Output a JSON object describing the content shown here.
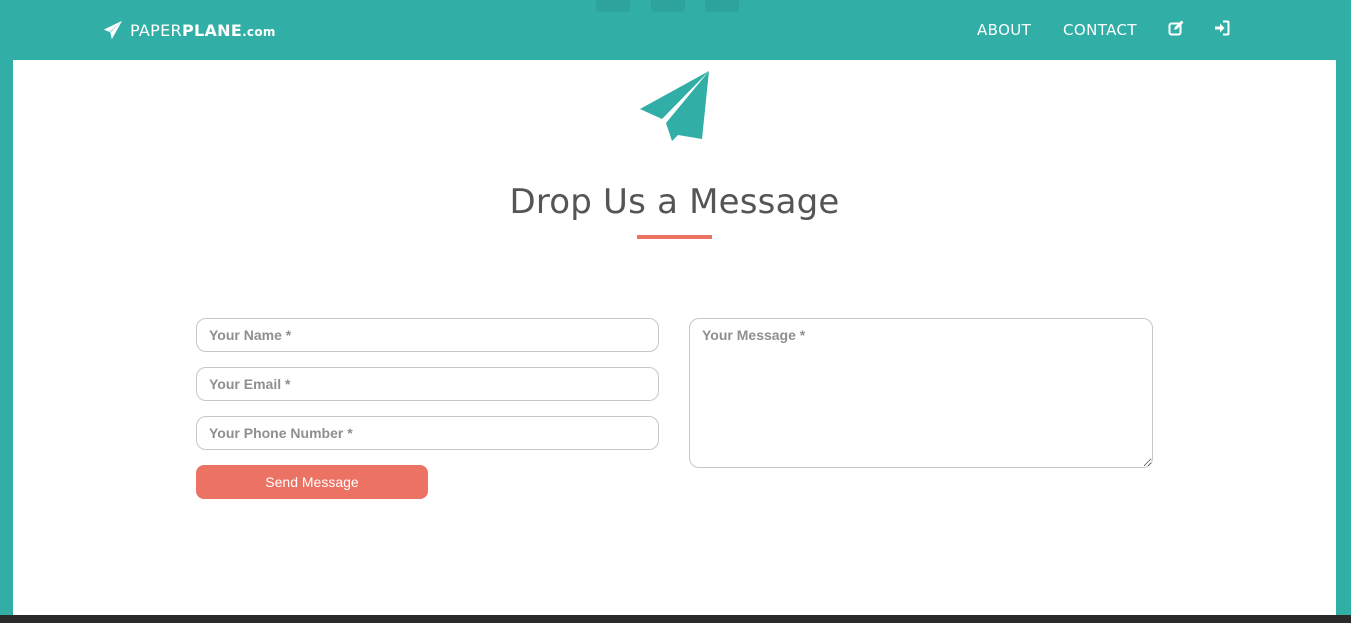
{
  "header": {
    "brand": {
      "light": "PAPER",
      "bold": "PLANE",
      "suffix": ".com"
    },
    "nav": [
      {
        "label": "ABOUT"
      },
      {
        "label": "CONTACT"
      }
    ],
    "icons": [
      "edit-icon",
      "login-icon"
    ],
    "background_social_icons": [
      "facebook-icon",
      "twitter-icon",
      "linkedin-icon"
    ]
  },
  "contact": {
    "title": "Drop Us a Message",
    "fields": {
      "name": {
        "placeholder": "Your Name *",
        "value": ""
      },
      "email": {
        "placeholder": "Your Email *",
        "value": ""
      },
      "phone": {
        "placeholder": "Your Phone Number *",
        "value": ""
      },
      "message": {
        "placeholder": "Your Message *",
        "value": ""
      }
    },
    "submit_label": "Send Message"
  },
  "colors": {
    "brand_teal": "#31aea6",
    "accent_coral": "#ec7263",
    "title_gray": "#555555",
    "footer_dark": "#2b2b2b"
  }
}
